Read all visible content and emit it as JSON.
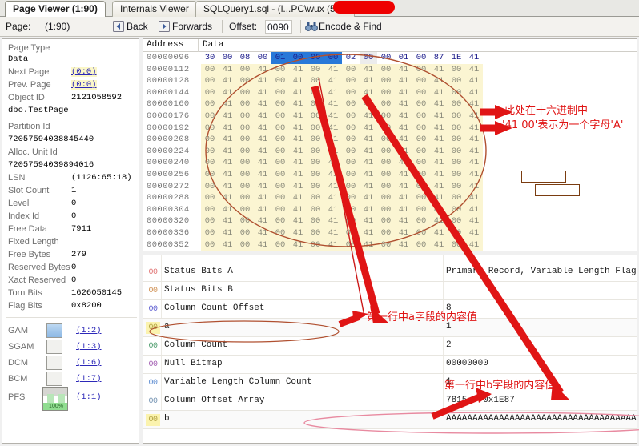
{
  "window": {
    "tabs": [
      {
        "label": "Page Viewer (1:90)",
        "active": true
      },
      {
        "label": "Internals Viewer",
        "active": false
      },
      {
        "label": "SQLQuery1.sql - (l...PC\\wux          (52))",
        "active": false
      }
    ]
  },
  "toolbar": {
    "page_label": "Page:",
    "page_value": "(1:90)",
    "back_label": "Back",
    "forwards_label": "Forwards",
    "offset_label": "Offset:",
    "offset_value": "0090",
    "encode_find_label": "Encode & Find",
    "back_icon": "back-arrow-icon",
    "forwards_icon": "forward-arrow-icon",
    "encode_icon": "binoculars-icon"
  },
  "sidebar": {
    "properties": [
      {
        "label": "Page Type",
        "value": "Data",
        "value_style": "mono-left"
      },
      {
        "label": "Next Page",
        "value": "(0:0)",
        "value_style": "link"
      },
      {
        "label": "Prev. Page",
        "value": "(0:0)",
        "value_style": "link"
      },
      {
        "label": "Object ID",
        "value": "2121058592",
        "value_style": "col2"
      },
      {
        "label": "",
        "value": "dbo.TestPage",
        "value_style": "mono-left"
      },
      {
        "label": "Partition Id",
        "value": "72057594038845440",
        "value_style": "mono-left"
      },
      {
        "label": "Alloc. Unit Id",
        "value": "72057594039894016",
        "value_style": "mono-left"
      },
      {
        "label": "LSN",
        "value": "(1126:65:18)",
        "value_style": "col2"
      },
      {
        "label": "Slot Count",
        "value": "1",
        "value_style": "col2"
      },
      {
        "label": "Level",
        "value": "0",
        "value_style": "col2"
      },
      {
        "label": "Index Id",
        "value": "0",
        "value_style": "col2"
      },
      {
        "label": "Free Data",
        "value": "7911",
        "value_style": "col2"
      },
      {
        "label": "Fixed Length",
        "value": "",
        "value_style": "col2"
      },
      {
        "label": "Free Bytes",
        "value": "279",
        "value_style": "col2"
      },
      {
        "label": "Reserved Bytes",
        "value": "0",
        "value_style": "col2"
      },
      {
        "label": "Xact Reserved",
        "value": "0",
        "value_style": "col2"
      },
      {
        "label": "Torn Bits",
        "value": "1626050145",
        "value_style": "col2"
      },
      {
        "label": "Flag Bits",
        "value": "0x8200",
        "value_style": "col2"
      }
    ],
    "allocation_maps": [
      {
        "label": "GAM",
        "checked": true,
        "link": "(1:2)"
      },
      {
        "label": "SGAM",
        "checked": false,
        "link": "(1:3)"
      },
      {
        "label": "DCM",
        "checked": false,
        "link": "(1:6)"
      },
      {
        "label": "BCM",
        "checked": false,
        "link": "(1:7)"
      }
    ],
    "pfs": {
      "label": "PFS",
      "link": "(1:1)",
      "fill_text": "100%"
    }
  },
  "hex": {
    "col_address": "Address",
    "col_data": "Data",
    "header_row": {
      "address": "00000096",
      "bytes": [
        {
          "v": "30",
          "cls": "red"
        },
        {
          "v": "00",
          "cls": "grey"
        },
        {
          "v": "08",
          "cls": "mag"
        },
        {
          "v": "00",
          "cls": "grey"
        },
        {
          "v": "01",
          "cls": "sel"
        },
        {
          "v": "00",
          "cls": "sel"
        },
        {
          "v": "00",
          "cls": "sel"
        },
        {
          "v": "00",
          "cls": "sel"
        },
        {
          "v": "02",
          "cls": "teal"
        },
        {
          "v": "00",
          "cls": "g1"
        },
        {
          "v": "00",
          "cls": "mag"
        },
        {
          "v": "01",
          "cls": "grey"
        },
        {
          "v": "00",
          "cls": "grey"
        },
        {
          "v": "87",
          "cls": "grey"
        },
        {
          "v": "1E",
          "cls": "grey"
        },
        {
          "v": "41",
          "cls": "grey"
        }
      ]
    },
    "data_addresses": [
      "00000112",
      "00000128",
      "00000144",
      "00000160",
      "00000176",
      "00000192",
      "00000208",
      "00000224",
      "00000240",
      "00000256",
      "00000272",
      "00000288",
      "00000304",
      "00000320",
      "00000336",
      "00000352"
    ],
    "data_pattern": [
      "00",
      "41",
      "00",
      "41",
      "00",
      "41",
      "00",
      "41",
      "00",
      "41",
      "00",
      "41",
      "00",
      "41",
      "00",
      "41"
    ]
  },
  "grid": {
    "rows": [
      {
        "mark": "00",
        "mark_color": "#e07070",
        "name": "Status Bits A",
        "value": "Primary Record, Variable Length Flag | NULL Bitmap Flag",
        "highlight": false
      },
      {
        "mark": "00",
        "mark_color": "#cf8f50",
        "name": "Status Bits B",
        "value": "",
        "highlight": false
      },
      {
        "mark": "00",
        "mark_color": "#5a5ad0",
        "name": "Column Count Offset",
        "value": "8",
        "highlight": false
      },
      {
        "mark": "00",
        "mark_color": "#b0a040",
        "name": "a",
        "value": "1",
        "highlight": true
      },
      {
        "mark": "00",
        "mark_color": "#4a9a6a",
        "name": "Column Count",
        "value": "2",
        "highlight": false
      },
      {
        "mark": "00",
        "mark_color": "#a05ab0",
        "name": "Null Bitmap",
        "value": "00000000",
        "highlight": false
      },
      {
        "mark": "00",
        "mark_color": "#5a8ad0",
        "name": "Variable Length Column Count",
        "value": "1",
        "highlight": false
      },
      {
        "mark": "00",
        "mark_color": "#7090b0",
        "name": "Column Offset Array",
        "value": "7815 - 0x1E87",
        "highlight": false
      },
      {
        "mark": "00",
        "mark_color": "#b0a040",
        "name": "b",
        "value": "AAAAAAAAAAAAAAAAAAAAAAAAAAAAAAAAAAAAAAAAAAAAAAAAAAAAAAAAAAAAAAAAAAAAAAAAAAAAAAA",
        "highlight": true
      }
    ]
  },
  "annotations": {
    "hex_note_line1": "此处在十六进制中",
    "hex_note_line2": "'41 00'表示为一个字母'A'",
    "field_a_note": "第一行中a字段的内容值",
    "field_b_note": "第一行中b字段的内容值",
    "accent_color": "#e01515",
    "circle_color": "#b05030"
  }
}
